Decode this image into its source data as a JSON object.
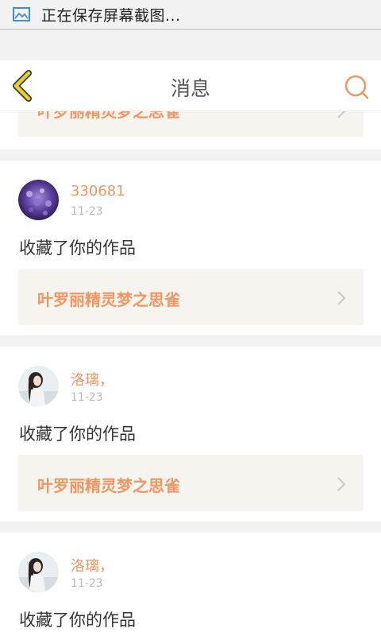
{
  "status_bar": {
    "text": "正在保存屏幕截图..."
  },
  "nav": {
    "title": "消息"
  },
  "peek": {
    "work_title": "叶罗丽精灵梦之思雀"
  },
  "messages": [
    {
      "user": "330681",
      "time": "11-23",
      "action": "收藏了你的作品",
      "work_title": "叶罗丽精灵梦之思雀",
      "avatar": "purple-flowers"
    },
    {
      "user": "洛璃，",
      "time": "11-23",
      "action": "收藏了你的作品",
      "work_title": "叶罗丽精灵梦之思雀",
      "avatar": "girl-portrait"
    },
    {
      "user": "洛璃，",
      "time": "11-23",
      "action": "收藏了你的作品",
      "work_title": "叶罗丽精灵梦之思雀",
      "avatar": "girl-portrait"
    }
  ],
  "colors": {
    "accent": "#ef9663",
    "back_arrow": "#e6d21e",
    "card_bg": "#f5f4ee"
  }
}
